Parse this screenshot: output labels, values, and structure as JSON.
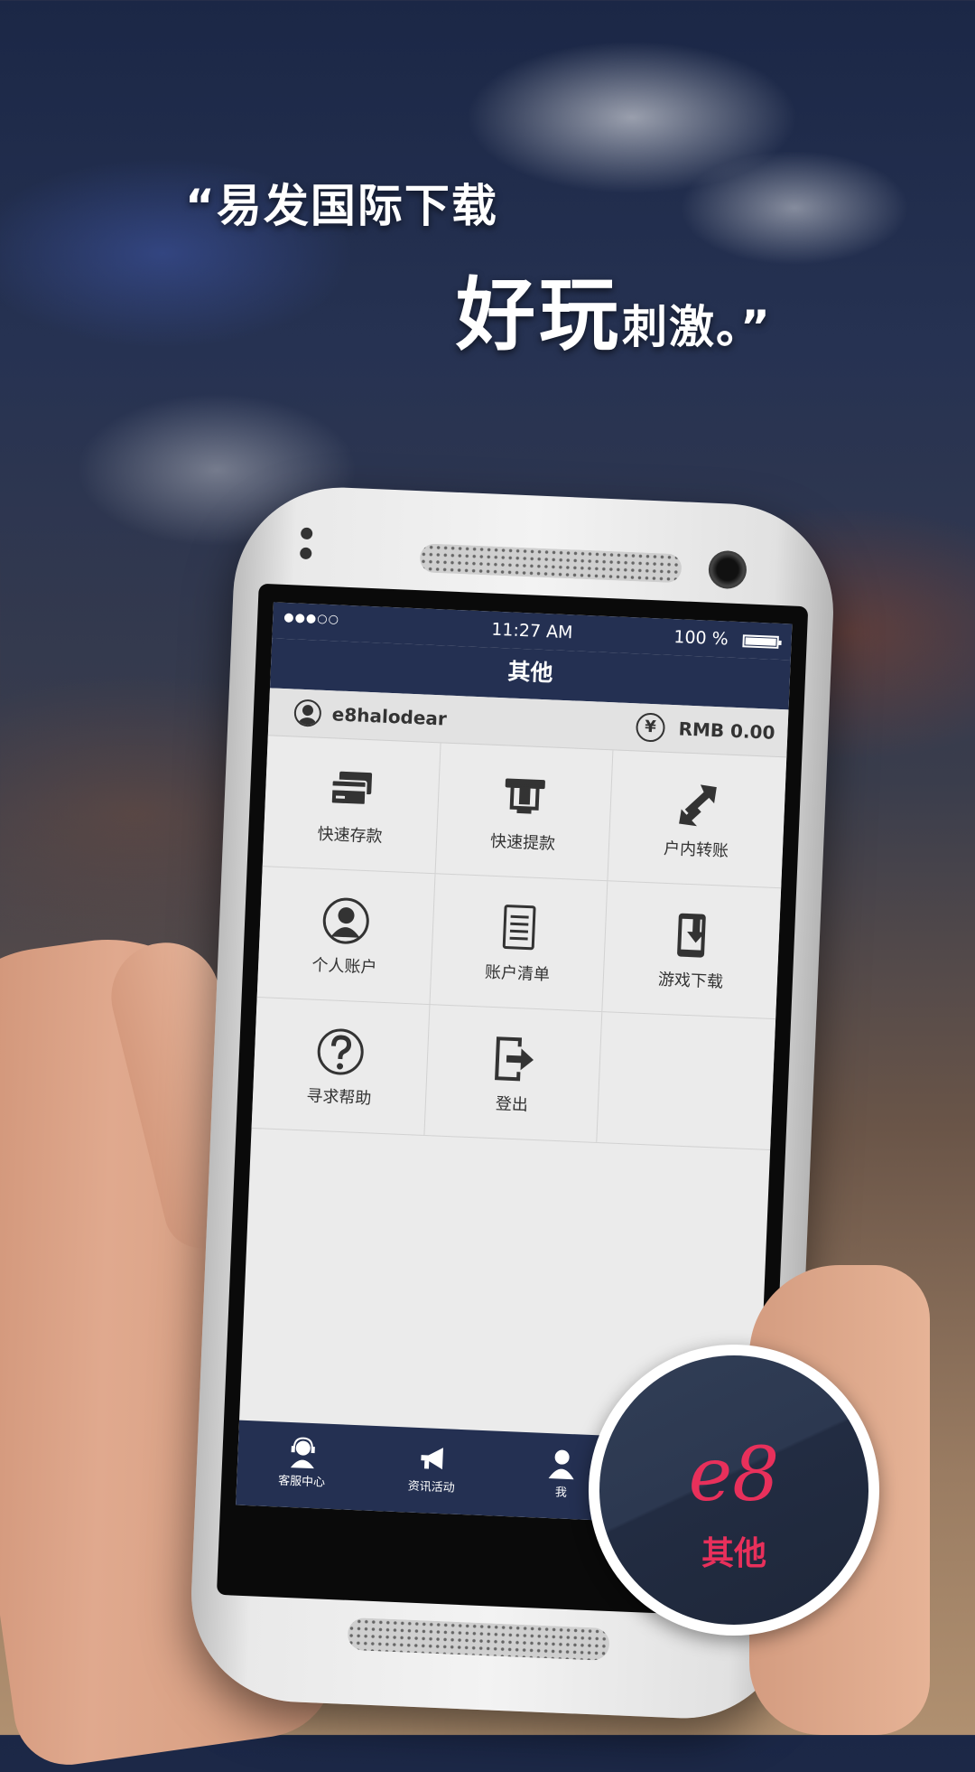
{
  "headline": {
    "line1": "“易发国际下载",
    "line2_big": "好玩",
    "line2_small": "刺激。”"
  },
  "status_bar": {
    "signal": "●●●○○",
    "time": "11:27 AM",
    "battery": "100 %"
  },
  "title": "其他",
  "account": {
    "username": "e8halodear",
    "currency_symbol": "¥",
    "balance": "RMB 0.00"
  },
  "menu": [
    {
      "label": "快速存款",
      "icon": "card-icon"
    },
    {
      "label": "快速提款",
      "icon": "atm-icon"
    },
    {
      "label": "户内转账",
      "icon": "transfer-icon"
    },
    {
      "label": "个人账户",
      "icon": "user-icon"
    },
    {
      "label": "账户清单",
      "icon": "document-icon"
    },
    {
      "label": "游戏下载",
      "icon": "download-icon"
    },
    {
      "label": "寻求帮助",
      "icon": "help-icon"
    },
    {
      "label": "登出",
      "icon": "logout-icon"
    }
  ],
  "tabs": [
    {
      "label": "客服中心",
      "icon": "support-agent-icon"
    },
    {
      "label": "资讯活动",
      "icon": "megaphone-icon"
    },
    {
      "label": "我",
      "icon": "person-icon"
    }
  ],
  "badge": {
    "logo": "e8",
    "label": "其他"
  },
  "colors": {
    "nav_bg": "#243052",
    "accent": "#e8305b",
    "screen_bg": "#ebebeb"
  }
}
